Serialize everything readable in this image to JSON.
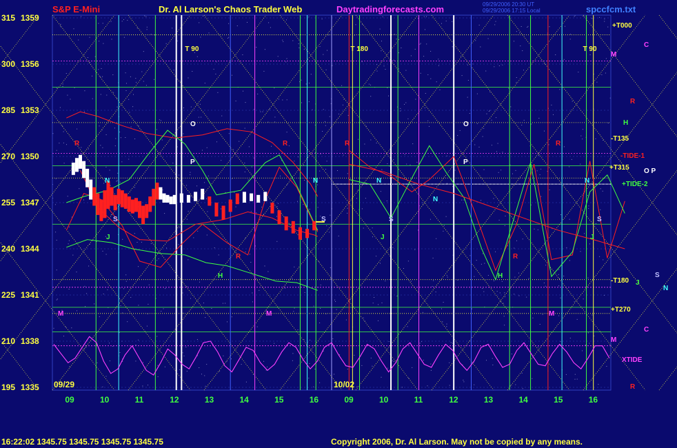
{
  "header": {
    "left": "S&P E-Mini",
    "center": "Dr. Al Larson's Chaos Trader Web",
    "site": "Daytradingforecasts.com",
    "filename": "spccfcm.txt",
    "stamp1": "09/29/2006 20:30 UT",
    "stamp2": "09/29/2006 17:15 Local"
  },
  "footer": {
    "quote": "16:22:02  1345.75  1345.75  1345.75  1345.75",
    "copyright": "Copyright 2006, Dr. Al Larson. May not be copied by any means."
  },
  "colors": {
    "background": "#0a0a6e",
    "yellow": "#ffff40",
    "green": "#40ff40",
    "red": "#ff2020",
    "magenta": "#ff40ff",
    "white": "#ffffff",
    "cyan": "#40ffff"
  },
  "chart_data": {
    "type": "line",
    "y_axis": {
      "angle_ticks": [
        "315",
        "300",
        "285",
        "270",
        "255",
        "240",
        "225",
        "210",
        "195"
      ],
      "price_ticks": [
        "1359",
        "1356",
        "1353",
        "1350",
        "1347",
        "1344",
        "1341",
        "1338",
        "1335"
      ],
      "range": [
        1335,
        1359
      ]
    },
    "x_axis": {
      "hour_ticks": [
        "09",
        "10",
        "11",
        "12",
        "13",
        "14",
        "15",
        "16",
        "09",
        "10",
        "11",
        "12",
        "13",
        "14",
        "15",
        "16"
      ],
      "dates": [
        "09/29",
        "10/02"
      ]
    },
    "chart_labels": {
      "turns": [
        "T 90",
        "T 180",
        "T 90"
      ],
      "markers": [
        "O",
        "P",
        "O",
        "P",
        "N",
        "N",
        "N",
        "N",
        "N",
        "S",
        "S",
        "S",
        "S",
        "J",
        "J",
        "J",
        "H",
        "H",
        "R",
        "R",
        "R",
        "R",
        "R",
        "R",
        "M",
        "M",
        "M"
      ]
    },
    "right_labels": [
      "+T000",
      "M",
      "C",
      "R",
      "H",
      "-T135",
      "-TIDE-1",
      "+T315",
      "O P",
      "+TIDE-2",
      "-T180",
      "J",
      "S",
      "N",
      "+T270",
      "C",
      "M",
      "XTIDE",
      "R"
    ],
    "price_bars": [
      {
        "t": 9.1,
        "h": 1349.6,
        "l": 1348.8
      },
      {
        "t": 9.2,
        "h": 1349.9,
        "l": 1349.0
      },
      {
        "t": 9.3,
        "h": 1350.1,
        "l": 1349.2
      },
      {
        "t": 9.4,
        "h": 1349.7,
        "l": 1348.6
      },
      {
        "t": 9.5,
        "h": 1349.2,
        "l": 1348.0
      },
      {
        "t": 9.6,
        "h": 1348.5,
        "l": 1347.2
      },
      {
        "t": 9.7,
        "h": 1348.0,
        "l": 1346.8
      },
      {
        "t": 9.8,
        "h": 1347.6,
        "l": 1346.2
      },
      {
        "t": 9.9,
        "h": 1347.2,
        "l": 1345.8
      },
      {
        "t": 10.0,
        "h": 1347.8,
        "l": 1346.0
      },
      {
        "t": 10.1,
        "h": 1348.4,
        "l": 1346.6
      },
      {
        "t": 10.2,
        "h": 1348.0,
        "l": 1346.8
      },
      {
        "t": 10.3,
        "h": 1347.5,
        "l": 1346.5
      },
      {
        "t": 10.4,
        "h": 1347.9,
        "l": 1346.9
      },
      {
        "t": 10.5,
        "h": 1347.8,
        "l": 1346.7
      },
      {
        "t": 10.6,
        "h": 1347.6,
        "l": 1346.6
      },
      {
        "t": 10.7,
        "h": 1347.4,
        "l": 1346.4
      },
      {
        "t": 10.8,
        "h": 1347.2,
        "l": 1346.3
      },
      {
        "t": 10.9,
        "h": 1347.3,
        "l": 1346.4
      },
      {
        "t": 11.0,
        "h": 1347.1,
        "l": 1346.0
      },
      {
        "t": 11.1,
        "h": 1346.8,
        "l": 1345.6
      },
      {
        "t": 11.2,
        "h": 1346.9,
        "l": 1346.0
      },
      {
        "t": 11.3,
        "h": 1347.4,
        "l": 1346.4
      },
      {
        "t": 11.4,
        "h": 1347.9,
        "l": 1346.8
      },
      {
        "t": 11.5,
        "h": 1348.3,
        "l": 1347.2
      },
      {
        "t": 11.6,
        "h": 1348.0,
        "l": 1347.2
      },
      {
        "t": 11.7,
        "h": 1347.6,
        "l": 1347.0
      },
      {
        "t": 11.8,
        "h": 1347.5,
        "l": 1347.0
      },
      {
        "t": 11.9,
        "h": 1347.4,
        "l": 1346.9
      },
      {
        "t": 12.0,
        "h": 1347.5,
        "l": 1346.9
      },
      {
        "t": 12.2,
        "h": 1347.6,
        "l": 1347.0
      },
      {
        "t": 12.4,
        "h": 1347.5,
        "l": 1347.0
      },
      {
        "t": 12.6,
        "h": 1347.7,
        "l": 1347.1
      },
      {
        "t": 12.8,
        "h": 1347.9,
        "l": 1347.2
      },
      {
        "t": 13.0,
        "h": 1347.4,
        "l": 1346.8
      },
      {
        "t": 13.2,
        "h": 1347.0,
        "l": 1346.1
      },
      {
        "t": 13.4,
        "h": 1346.8,
        "l": 1345.9
      },
      {
        "t": 13.6,
        "h": 1347.2,
        "l": 1346.4
      },
      {
        "t": 13.8,
        "h": 1347.6,
        "l": 1346.9
      },
      {
        "t": 14.0,
        "h": 1347.7,
        "l": 1347.0
      },
      {
        "t": 14.2,
        "h": 1347.6,
        "l": 1347.1
      },
      {
        "t": 14.4,
        "h": 1347.5,
        "l": 1347.0
      },
      {
        "t": 14.6,
        "h": 1347.7,
        "l": 1347.1
      },
      {
        "t": 14.8,
        "h": 1347.0,
        "l": 1346.3
      },
      {
        "t": 15.0,
        "h": 1346.5,
        "l": 1345.6
      },
      {
        "t": 15.2,
        "h": 1346.1,
        "l": 1345.2
      },
      {
        "t": 15.4,
        "h": 1345.8,
        "l": 1345.0
      },
      {
        "t": 15.6,
        "h": 1345.4,
        "l": 1344.6
      },
      {
        "t": 15.8,
        "h": 1345.3,
        "l": 1344.7
      },
      {
        "t": 16.0,
        "h": 1345.8,
        "l": 1345.2
      }
    ],
    "series": [
      {
        "color": "#ff2020",
        "points": [
          [
            8.9,
            1352.5
          ],
          [
            9.3,
            1352.9
          ],
          [
            9.8,
            1352.6
          ],
          [
            10.5,
            1352.0
          ],
          [
            11.2,
            1351.5
          ],
          [
            12.0,
            1351.2
          ],
          [
            12.8,
            1351.4
          ],
          [
            13.5,
            1351.8
          ],
          [
            14.2,
            1351.6
          ],
          [
            14.8,
            1350.9
          ],
          [
            15.4,
            1349.6
          ],
          [
            15.9,
            1348.2
          ],
          [
            16.1,
            1347.4
          ]
        ]
      },
      {
        "color": "#ff2020",
        "points": [
          [
            8.9,
            1345.2
          ],
          [
            9.4,
            1347.6
          ],
          [
            9.9,
            1347.2
          ],
          [
            10.5,
            1345.5
          ],
          [
            11.0,
            1343.2
          ],
          [
            11.6,
            1342.8
          ],
          [
            12.2,
            1344.3
          ],
          [
            12.8,
            1345.6
          ],
          [
            13.5,
            1344.4
          ],
          [
            14.1,
            1343.6
          ],
          [
            14.6,
            1347.2
          ],
          [
            15.0,
            1349.3
          ],
          [
            15.5,
            1348.0
          ],
          [
            16.1,
            1345.1
          ]
        ]
      },
      {
        "color": "#ff2020",
        "points": [
          [
            9.3,
            1349.1
          ],
          [
            9.8,
            1346.7
          ],
          [
            10.4,
            1345.4
          ],
          [
            11.0,
            1344.6
          ],
          [
            11.8,
            1344.5
          ],
          [
            12.6,
            1345.6
          ],
          [
            13.4,
            1345.9
          ],
          [
            14.1,
            1346.4
          ],
          [
            14.8,
            1346.0
          ],
          [
            15.5,
            1345.2
          ],
          [
            16.0,
            1344.9
          ],
          [
            16.1,
            1344.8
          ]
        ]
      },
      {
        "color": "#40ff40",
        "points": [
          [
            8.9,
            1347.0
          ],
          [
            9.4,
            1347.4
          ],
          [
            10.1,
            1347.8
          ],
          [
            10.7,
            1348.5
          ],
          [
            11.3,
            1350.3
          ],
          [
            11.8,
            1351.7
          ],
          [
            12.3,
            1350.8
          ],
          [
            12.8,
            1349.1
          ],
          [
            13.2,
            1347.5
          ],
          [
            13.9,
            1347.8
          ],
          [
            14.6,
            1349.6
          ],
          [
            15.0,
            1350.1
          ],
          [
            15.5,
            1348.1
          ],
          [
            16.1,
            1345.2
          ]
        ]
      },
      {
        "color": "#40ff40",
        "points": [
          [
            8.9,
            1344.1
          ],
          [
            9.5,
            1344.6
          ],
          [
            10.2,
            1344.4
          ],
          [
            10.8,
            1344.0
          ],
          [
            11.6,
            1343.7
          ],
          [
            12.3,
            1343.6
          ],
          [
            12.9,
            1343.1
          ],
          [
            13.5,
            1342.9
          ],
          [
            14.2,
            1342.4
          ],
          [
            14.9,
            1341.9
          ],
          [
            15.5,
            1341.8
          ],
          [
            16.1,
            1341.3
          ]
        ]
      },
      {
        "color": "#ff2020",
        "points": [
          [
            17.0,
            1350.4
          ],
          [
            17.6,
            1349.3
          ],
          [
            18.2,
            1348.7
          ],
          [
            18.8,
            1347.7
          ],
          [
            19.3,
            1348.5
          ],
          [
            20.0,
            1350.0
          ],
          [
            20.6,
            1346.4
          ],
          [
            21.2,
            1342.6
          ],
          [
            21.8,
            1345.6
          ],
          [
            22.3,
            1349.5
          ],
          [
            22.8,
            1343.3
          ],
          [
            23.4,
            1343.6
          ],
          [
            23.9,
            1349.7
          ],
          [
            24.4,
            1343.4
          ],
          [
            24.9,
            1347.1
          ]
        ]
      },
      {
        "color": "#40ff40",
        "points": [
          [
            17.0,
            1348.5
          ],
          [
            17.6,
            1348.2
          ],
          [
            18.2,
            1346.0
          ],
          [
            18.8,
            1348.6
          ],
          [
            19.3,
            1350.7
          ],
          [
            19.8,
            1348.9
          ],
          [
            20.3,
            1347.3
          ],
          [
            20.8,
            1344.0
          ],
          [
            21.2,
            1342.0
          ],
          [
            21.7,
            1345.8
          ],
          [
            22.2,
            1349.6
          ],
          [
            22.8,
            1342.2
          ],
          [
            23.4,
            1343.8
          ],
          [
            23.9,
            1347.7
          ],
          [
            24.4,
            1348.8
          ],
          [
            24.9,
            1346.3
          ]
        ]
      },
      {
        "color": "#ff2020",
        "points": [
          [
            17.0,
            1349.5
          ],
          [
            18.0,
            1349.0
          ],
          [
            19.0,
            1348.2
          ],
          [
            20.0,
            1347.6
          ],
          [
            21.0,
            1346.8
          ],
          [
            22.0,
            1346.0
          ],
          [
            23.0,
            1345.2
          ],
          [
            24.0,
            1344.6
          ],
          [
            24.9,
            1344.0
          ]
        ]
      }
    ],
    "xtide": {
      "color": "#ff40ff",
      "values": [
        1337.8,
        1337.2,
        1336.6,
        1336.9,
        1337.6,
        1338.3,
        1337.9,
        1336.7,
        1335.9,
        1336.2,
        1337.1,
        1337.7,
        1336.9,
        1336.1,
        1335.8,
        1336.6,
        1337.5,
        1337.1,
        1336.5,
        1336.2,
        1337.0,
        1337.9,
        1338.0,
        1337.3,
        1336.4,
        1336.0,
        1336.8,
        1337.6,
        1337.4,
        1336.6,
        1336.1,
        1336.5,
        1337.3,
        1337.9,
        1337.6,
        1336.8,
        1336.2,
        1336.7,
        1337.6,
        1337.9,
        1337.1,
        1336.4,
        1336.3,
        1337.0,
        1337.8,
        1337.5,
        1336.7,
        1336.0,
        1336.6,
        1337.5,
        1337.9,
        1337.2,
        1336.5,
        1336.3,
        1337.1,
        1337.8,
        1337.4,
        1336.6,
        1336.1,
        1336.7,
        1337.6,
        1337.8,
        1337.0,
        1336.3,
        1336.5,
        1337.4,
        1337.9,
        1337.2,
        1336.5,
        1336.4,
        1337.2,
        1337.8,
        1337.3,
        1336.6,
        1336.2,
        1336.9,
        1337.7,
        1337.7,
        1336.9
      ]
    }
  }
}
